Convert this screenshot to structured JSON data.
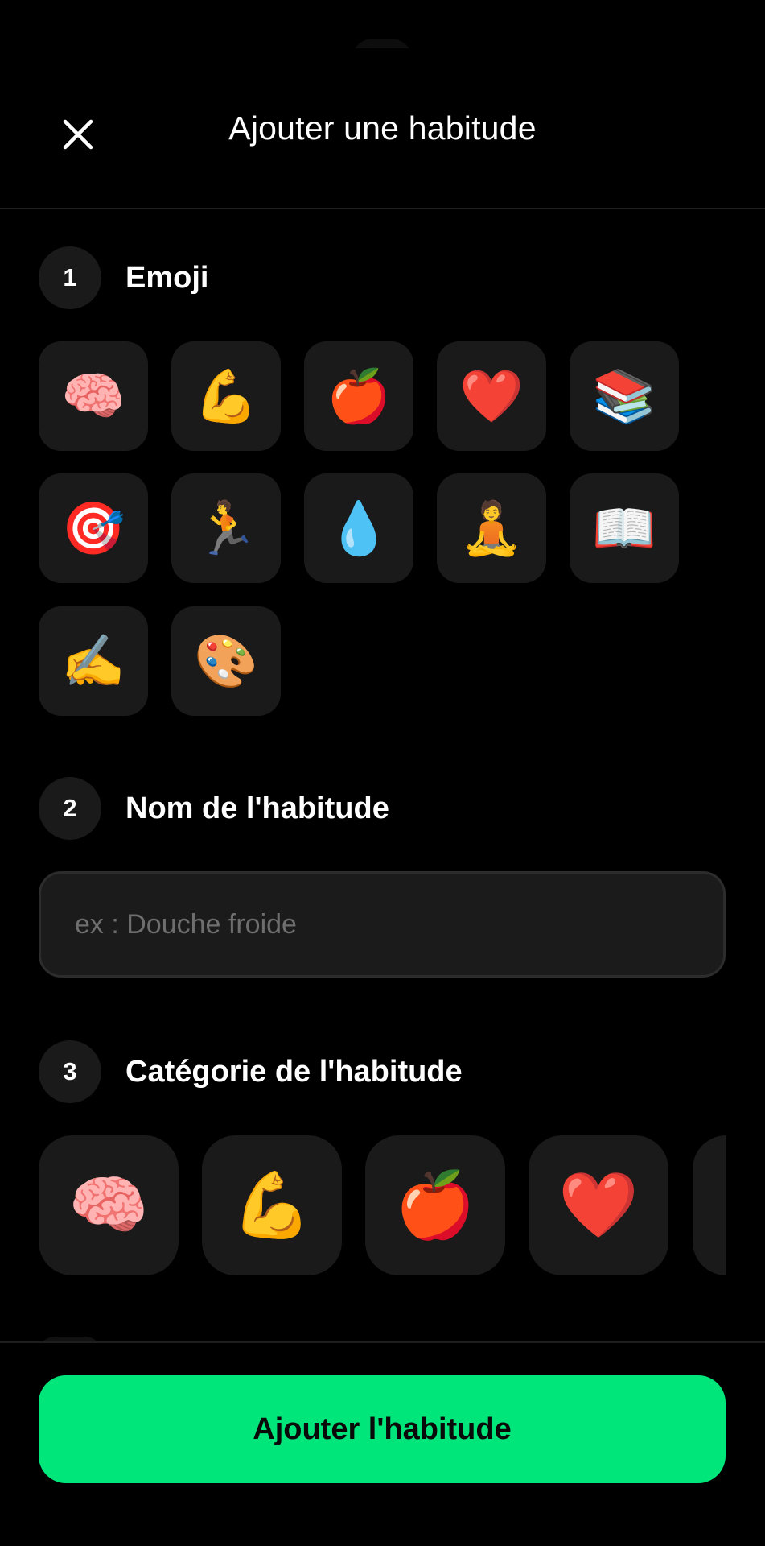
{
  "header": {
    "title": "Ajouter une habitude",
    "close_icon": "close-icon"
  },
  "steps": [
    {
      "number": "1",
      "label": "Emoji"
    },
    {
      "number": "2",
      "label": "Nom de l'habitude"
    },
    {
      "number": "3",
      "label": "Catégorie de l'habitude"
    }
  ],
  "emojis": [
    "🧠",
    "💪",
    "🍎",
    "❤️",
    "📚",
    "🎯",
    "🏃",
    "💧",
    "🧘",
    "📖",
    "✍️",
    "🎨"
  ],
  "name_field": {
    "value": "",
    "placeholder": "ex : Douche froide"
  },
  "categories": [
    "🧠",
    "💪",
    "🍎",
    "❤️",
    ""
  ],
  "footer": {
    "submit_label": "Ajouter l'habitude",
    "accent_color": "#00e67b"
  }
}
